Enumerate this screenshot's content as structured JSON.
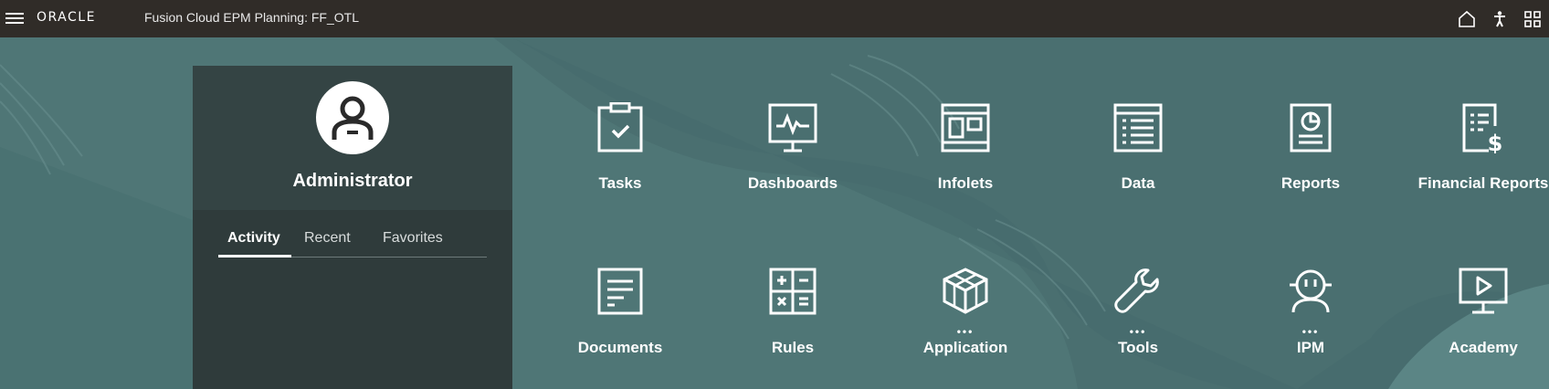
{
  "header": {
    "logo": "ORACLE",
    "app_title": "Fusion Cloud EPM Planning:  FF_OTL",
    "icons": [
      "menu-icon",
      "home-icon",
      "accessibility-icon",
      "navigator-grid-icon"
    ]
  },
  "profile": {
    "name": "Administrator",
    "tabs": [
      {
        "label": "Activity",
        "active": true
      },
      {
        "label": "Recent",
        "active": false
      },
      {
        "label": "Favorites",
        "active": false
      }
    ]
  },
  "tiles": [
    {
      "label": "Tasks",
      "icon": "clipboard-check-icon"
    },
    {
      "label": "Dashboards",
      "icon": "monitor-chart-icon"
    },
    {
      "label": "Infolets",
      "icon": "infolet-panel-icon"
    },
    {
      "label": "Data",
      "icon": "data-form-icon"
    },
    {
      "label": "Reports",
      "icon": "report-pie-icon"
    },
    {
      "label": "Financial Reports",
      "icon": "financial-report-icon"
    },
    {
      "label": "Documents",
      "icon": "document-icon"
    },
    {
      "label": "Rules",
      "icon": "calculator-icon"
    },
    {
      "label": "Application",
      "icon": "cube-icon",
      "more": "•••"
    },
    {
      "label": "Tools",
      "icon": "wrench-icon",
      "more": "•••"
    },
    {
      "label": "IPM",
      "icon": "ipm-robot-icon",
      "more": "•••"
    },
    {
      "label": "Academy",
      "icon": "play-screen-icon"
    }
  ],
  "colors": {
    "topbar": "#302c28",
    "background": "#4f7676",
    "panel": "#2f3b3b"
  }
}
